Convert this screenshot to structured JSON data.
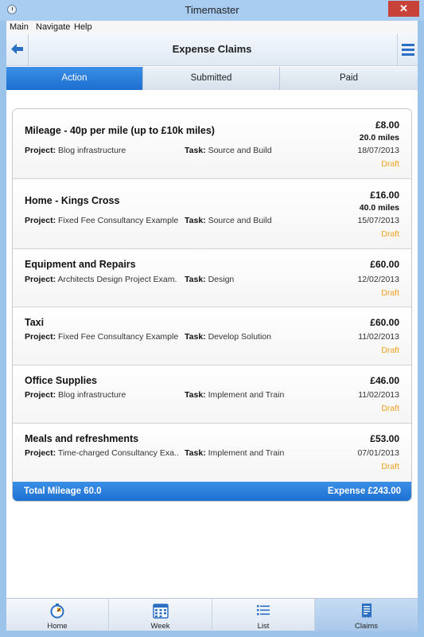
{
  "window": {
    "title": "Timemaster",
    "close": "✕"
  },
  "menu": {
    "main": "Main",
    "navigate": "Navigate",
    "help": "Help"
  },
  "header": {
    "title": "Expense Claims"
  },
  "tabs": {
    "action": "Action",
    "submitted": "Submitted",
    "paid": "Paid"
  },
  "labels": {
    "project": "Project:",
    "task": "Task:"
  },
  "claims": [
    {
      "title": "Mileage - 40p per mile (up to £10k miles)",
      "amount": "£8.00",
      "miles": "20.0 miles",
      "project": "Blog infrastructure",
      "task": "Source and Build",
      "date": "18/07/2013",
      "status": "Draft"
    },
    {
      "title": "Home - Kings Cross",
      "amount": "£16.00",
      "miles": "40.0 miles",
      "project": "Fixed Fee Consultancy Example",
      "task": "Source and Build",
      "date": "15/07/2013",
      "status": "Draft"
    },
    {
      "title": "Equipment and Repairs",
      "amount": "£60.00",
      "project": "Architects Design Project Exam.",
      "task": "Design",
      "date": "12/02/2013",
      "status": "Draft"
    },
    {
      "title": "Taxi",
      "amount": "£60.00",
      "project": "Fixed Fee Consultancy Example",
      "task": "Develop Solution",
      "date": "11/02/2013",
      "status": "Draft"
    },
    {
      "title": "Office Supplies",
      "amount": "£46.00",
      "project": "Blog infrastructure",
      "task": "Implement and Train",
      "date": "11/02/2013",
      "status": "Draft"
    },
    {
      "title": "Meals and refreshments",
      "amount": "£53.00",
      "project": "Time-charged Consultancy Exa..",
      "task": "Implement and Train",
      "date": "07/01/2013",
      "status": "Draft"
    }
  ],
  "totals": {
    "mileage": "Total Mileage 60.0",
    "expense": "Expense £243.00"
  },
  "bottom_nav": {
    "home": "Home",
    "week": "Week",
    "list": "List",
    "claims": "Claims"
  },
  "colors": {
    "accent": "#1d6fd0",
    "draft": "#f0a020",
    "close": "#c7433a"
  }
}
